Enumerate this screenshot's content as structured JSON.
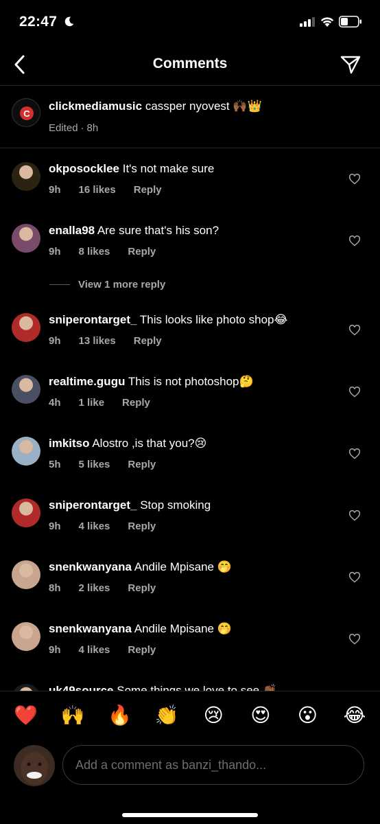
{
  "status": {
    "time": "22:47"
  },
  "nav": {
    "title": "Comments"
  },
  "caption": {
    "username": "clickmediamusic",
    "text": "cassper nyovest 🙌🏾👑",
    "edited": "Edited",
    "time": "8h"
  },
  "comments": [
    {
      "username": "okposocklee",
      "text": "It's not make sure",
      "time": "9h",
      "likes": "16 likes",
      "reply": "Reply",
      "avatar_color": "#2a2312"
    },
    {
      "username": "enalla98",
      "text": "Are sure that's his son?",
      "time": "9h",
      "likes": "8 likes",
      "reply": "Reply",
      "avatar_color": "#7a4a6a"
    },
    {
      "username": "sniperontarget_",
      "text": "This looks like photo shop😂",
      "time": "9h",
      "likes": "13 likes",
      "reply": "Reply",
      "avatar_color": "#b12a2a"
    },
    {
      "username": "realtime.gugu",
      "text": "This is not photoshop🤔",
      "time": "4h",
      "likes": "1 like",
      "reply": "Reply",
      "avatar_color": "#4a4f63"
    },
    {
      "username": "imkitso",
      "text": "Alostro ,is that you?😢",
      "time": "5h",
      "likes": "5 likes",
      "reply": "Reply",
      "avatar_color": "#9ab0c4"
    },
    {
      "username": "sniperontarget_",
      "text": "Stop smoking",
      "time": "9h",
      "likes": "4 likes",
      "reply": "Reply",
      "avatar_color": "#b12a2a"
    },
    {
      "username": "snenkwanyana",
      "text": "Andile Mpisane 🤭",
      "time": "8h",
      "likes": "2 likes",
      "reply": "Reply",
      "avatar_color": "#c9a48e"
    },
    {
      "username": "snenkwanyana",
      "text": "Andile Mpisane 🤭",
      "time": "9h",
      "likes": "4 likes",
      "reply": "Reply",
      "avatar_color": "#c9a48e"
    },
    {
      "username": "uk49source",
      "text": "Some things we love to see 👏🏾",
      "time": "",
      "likes": "",
      "reply": "",
      "avatar_color": "#1a1a1a"
    }
  ],
  "more_replies": "View 1 more reply",
  "emoji_bar": [
    "❤️",
    "🙌",
    "🔥",
    "👏",
    "😢",
    "😍",
    "😮",
    "😂"
  ],
  "compose": {
    "placeholder": "Add a comment as banzi_thando..."
  },
  "colors": {
    "background": "#000000",
    "secondary_text": "#a8a8a8",
    "divider": "#262626"
  }
}
